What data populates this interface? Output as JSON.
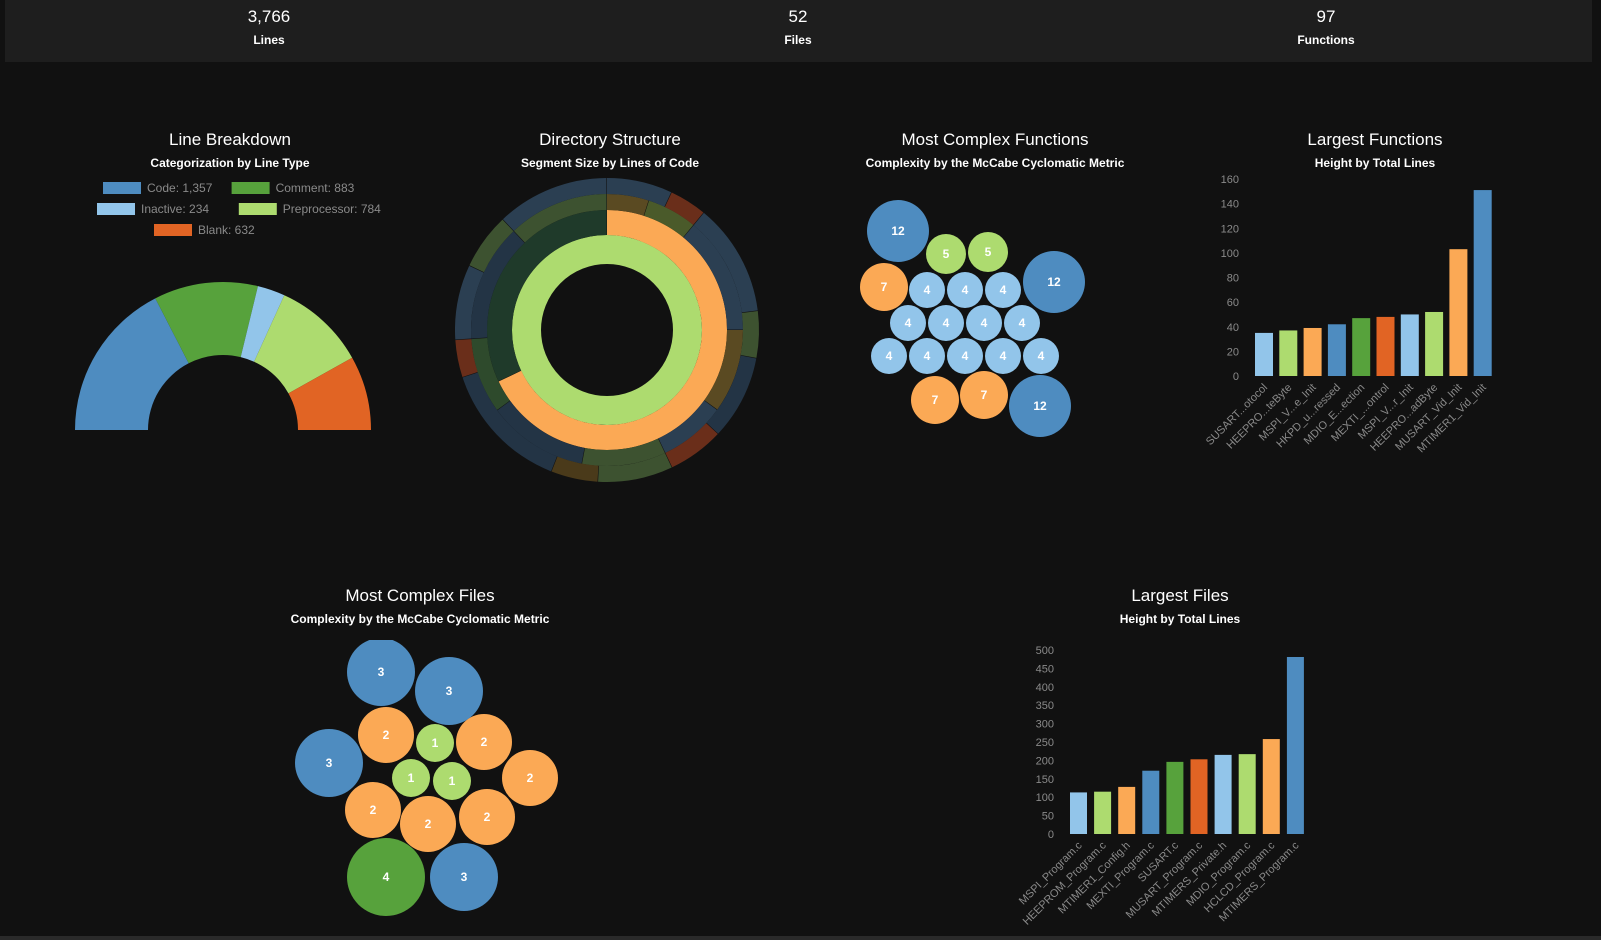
{
  "stats": [
    {
      "value": "3,766",
      "label": "Lines"
    },
    {
      "value": "52",
      "label": "Files"
    },
    {
      "value": "97",
      "label": "Functions"
    }
  ],
  "colors": {
    "blue": "#4e8cc0",
    "green": "#57a23c",
    "light_blue": "#92c5ea",
    "light_green": "#addb6f",
    "orange": "#fba955",
    "red_orange": "#e16424"
  },
  "panels": {
    "line_breakdown": {
      "title": "Line Breakdown",
      "subtitle": "Categorization by Line Type"
    },
    "directory": {
      "title": "Directory Structure",
      "subtitle": "Segment Size by Lines of Code"
    },
    "complex_functions": {
      "title": "Most Complex Functions",
      "subtitle": "Complexity by the McCabe Cyclomatic Metric"
    },
    "largest_functions": {
      "title": "Largest Functions",
      "subtitle": "Height by Total Lines"
    },
    "complex_files": {
      "title": "Most Complex Files",
      "subtitle": "Complexity by the McCabe Cyclomatic Metric"
    },
    "largest_files": {
      "title": "Largest Files",
      "subtitle": "Height by Total Lines"
    }
  },
  "chart_data": [
    {
      "type": "pie",
      "title": "Line Breakdown",
      "subtitle": "Categorization by Line Type",
      "shape": "half-donut",
      "legend": "top",
      "slices": [
        {
          "label": "Code: 1,357",
          "name": "Code",
          "value": 1357,
          "color": "#4e8cc0"
        },
        {
          "label": "Comment: 883",
          "name": "Comment",
          "value": 883,
          "color": "#57a23c"
        },
        {
          "label": "Inactive: 234",
          "name": "Inactive",
          "value": 234,
          "color": "#92c5ea"
        },
        {
          "label": "Preprocessor: 784",
          "name": "Preprocessor",
          "value": 784,
          "color": "#addb6f"
        },
        {
          "label": "Blank: 632",
          "name": "Blank",
          "value": 632,
          "color": "#e16424"
        }
      ]
    },
    {
      "type": "pie",
      "title": "Directory Structure",
      "subtitle": "Segment Size by Lines of Code",
      "shape": "sunburst",
      "rings": [
        [
          {
            "value": 100,
            "color": "#addb6f"
          }
        ],
        [
          {
            "value": 68,
            "color": "#fba955"
          },
          {
            "value": 32,
            "color": "#1f3a2a"
          }
        ],
        [
          {
            "value": 5,
            "color": "#5a4a22"
          },
          {
            "value": 6,
            "color": "#4a5a2a"
          },
          {
            "value": 14,
            "color": "#2b3f52"
          },
          {
            "value": 10,
            "color": "#5a4a22"
          },
          {
            "value": 8,
            "color": "#2b3f52"
          },
          {
            "value": 10,
            "color": "#3d5230"
          },
          {
            "value": 12,
            "color": "#233445"
          },
          {
            "value": 9,
            "color": "#2e4a2c"
          },
          {
            "value": 14,
            "color": "#233445"
          },
          {
            "value": 12,
            "color": "#3d5230"
          }
        ],
        [
          {
            "value": 7,
            "color": "#2b3f52"
          },
          {
            "value": 4,
            "color": "#6a2e1a"
          },
          {
            "value": 12,
            "color": "#2b3f52"
          },
          {
            "value": 5,
            "color": "#3d5230"
          },
          {
            "value": 9,
            "color": "#233445"
          },
          {
            "value": 6,
            "color": "#6a2e1a"
          },
          {
            "value": 8,
            "color": "#3d5230"
          },
          {
            "value": 5,
            "color": "#4a3a1a"
          },
          {
            "value": 14,
            "color": "#233445"
          },
          {
            "value": 4,
            "color": "#6a2e1a"
          },
          {
            "value": 8,
            "color": "#2b3f52"
          },
          {
            "value": 6,
            "color": "#3d5230"
          },
          {
            "value": 12,
            "color": "#2b3f52"
          }
        ]
      ]
    },
    {
      "type": "bubble",
      "title": "Most Complex Functions",
      "subtitle": "Complexity by the McCabe Cyclomatic Metric",
      "values": [
        12,
        5,
        5,
        12,
        7,
        4,
        4,
        4,
        4,
        4,
        4,
        4,
        4,
        4,
        4,
        4,
        4,
        7,
        7,
        12
      ],
      "colors": [
        "#4e8cc0",
        "#addb6f",
        "#addb6f",
        "#4e8cc0",
        "#fba955",
        "#92c5ea",
        "#92c5ea",
        "#92c5ea",
        "#92c5ea",
        "#92c5ea",
        "#92c5ea",
        "#92c5ea",
        "#92c5ea",
        "#92c5ea",
        "#92c5ea",
        "#92c5ea",
        "#92c5ea",
        "#fba955",
        "#fba955",
        "#4e8cc0"
      ]
    },
    {
      "type": "bar",
      "title": "Largest Functions",
      "subtitle": "Height by Total Lines",
      "categories": [
        "SUSART...otocol",
        "HEEPRO...teByte",
        "MSPI_V...e_Init",
        "HKPD_u...ressed",
        "MDIO_E...ection",
        "MEXTI_...ontrol",
        "MSPI_V...r_Init",
        "HEEPRO...adByte",
        "MUSART_Vid_Init",
        "MTIMER1_Vid_Init"
      ],
      "values": [
        35,
        37,
        39,
        42,
        47,
        48,
        50,
        52,
        103,
        151
      ],
      "colors": [
        "#92c5ea",
        "#addb6f",
        "#fba955",
        "#4e8cc0",
        "#57a23c",
        "#e16424",
        "#92c5ea",
        "#addb6f",
        "#fba955",
        "#4e8cc0"
      ],
      "ylim": [
        0,
        160
      ],
      "yticks": [
        0,
        20,
        40,
        60,
        80,
        100,
        120,
        140,
        160
      ],
      "grid": false
    },
    {
      "type": "bubble",
      "title": "Most Complex Files",
      "subtitle": "Complexity by the McCabe Cyclomatic Metric",
      "values": [
        3,
        3,
        2,
        1,
        2,
        3,
        1,
        1,
        2,
        2,
        2,
        2,
        4,
        3
      ],
      "colors": [
        "#4e8cc0",
        "#4e8cc0",
        "#fba955",
        "#addb6f",
        "#fba955",
        "#4e8cc0",
        "#addb6f",
        "#addb6f",
        "#fba955",
        "#fba955",
        "#fba955",
        "#fba955",
        "#57a23c",
        "#4e8cc0"
      ]
    },
    {
      "type": "bar",
      "title": "Largest Files",
      "subtitle": "Height by Total Lines",
      "categories": [
        "MSPI_Program.c",
        "HEEPROM_Program.c",
        "MTIMER1_Config.h",
        "MEXTI_Program.c",
        "SUSART.c",
        "MUSART_Program.c",
        "MTIMERS_Private.h",
        "MDIO_Program.c",
        "HCLCD_Program.c",
        "MTIMERS_Program.c"
      ],
      "values": [
        113,
        115,
        128,
        172,
        196,
        203,
        215,
        217,
        258,
        481
      ],
      "colors": [
        "#92c5ea",
        "#addb6f",
        "#fba955",
        "#4e8cc0",
        "#57a23c",
        "#e16424",
        "#92c5ea",
        "#addb6f",
        "#fba955",
        "#4e8cc0"
      ],
      "ylim": [
        0,
        500
      ],
      "yticks": [
        0,
        50,
        100,
        150,
        200,
        250,
        300,
        350,
        400,
        450,
        500
      ],
      "grid": false
    }
  ]
}
